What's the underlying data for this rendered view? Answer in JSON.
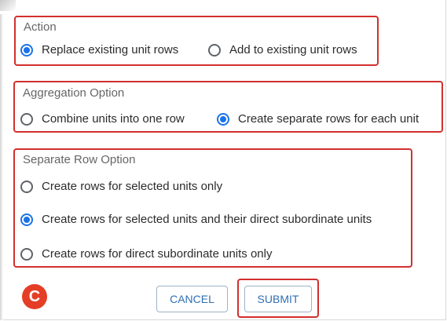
{
  "groups": {
    "action": {
      "title": "Action",
      "options": [
        {
          "label": "Replace existing unit rows",
          "checked": true
        },
        {
          "label": "Add to existing unit rows",
          "checked": false
        }
      ]
    },
    "aggregation": {
      "title": "Aggregation Option",
      "options": [
        {
          "label": "Combine units into one row",
          "checked": false
        },
        {
          "label": "Create separate rows for each unit",
          "checked": true
        }
      ]
    },
    "separate_row": {
      "title": "Separate Row Option",
      "options": [
        {
          "label": "Create rows for selected units only",
          "checked": false
        },
        {
          "label": "Create rows for selected units and their direct subordinate units",
          "checked": true
        },
        {
          "label": "Create rows for direct subordinate units only",
          "checked": false
        }
      ]
    }
  },
  "badge": {
    "letter": "C"
  },
  "buttons": {
    "cancel": "CANCEL",
    "submit": "SUBMIT"
  },
  "colors": {
    "highlight": "#d32f2f",
    "radio_checked": "#1a73e8",
    "badge": "#e53e27",
    "button_text": "#2f6fb3"
  }
}
